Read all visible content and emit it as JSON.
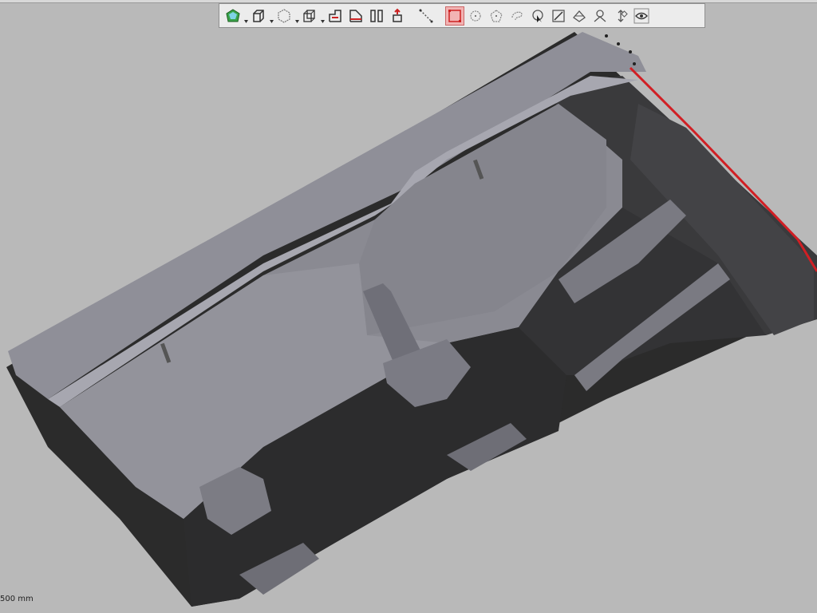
{
  "viewport": {
    "scale_label": "500 mm",
    "background_color": "#b9b9b9",
    "model_color_light": "#8e8e96",
    "model_color_dark": "#2a2a2a",
    "highlight_edge_color": "#d11f24"
  },
  "toolbar": {
    "items": [
      {
        "icon": "view-cube-iso-icon",
        "has_dropdown": true
      },
      {
        "icon": "box-view-icon",
        "has_dropdown": true
      },
      {
        "icon": "render-mode-icon",
        "has_dropdown": true
      },
      {
        "icon": "wireframe-box-icon",
        "has_dropdown": true
      },
      {
        "icon": "section-plane-icon",
        "has_dropdown": false
      },
      {
        "icon": "section-box-icon",
        "has_dropdown": false
      },
      {
        "icon": "split-view-icon",
        "has_dropdown": false
      },
      {
        "icon": "explode-icon",
        "has_dropdown": false
      },
      {
        "icon": "measure-distance-icon",
        "has_dropdown": false
      },
      {
        "icon": "select-rectangle-icon",
        "has_dropdown": false,
        "active": true
      },
      {
        "icon": "select-circle-icon",
        "has_dropdown": false
      },
      {
        "icon": "select-polygon-icon",
        "has_dropdown": false
      },
      {
        "icon": "select-freeform-icon",
        "has_dropdown": false
      },
      {
        "icon": "select-pointer-icon",
        "has_dropdown": false
      },
      {
        "icon": "annotate-icon",
        "has_dropdown": false
      },
      {
        "icon": "hide-part-icon",
        "has_dropdown": false
      },
      {
        "icon": "isolate-part-icon",
        "has_dropdown": false
      },
      {
        "icon": "move-part-icon",
        "has_dropdown": false
      },
      {
        "icon": "visibility-eye-icon",
        "has_dropdown": false
      }
    ]
  }
}
